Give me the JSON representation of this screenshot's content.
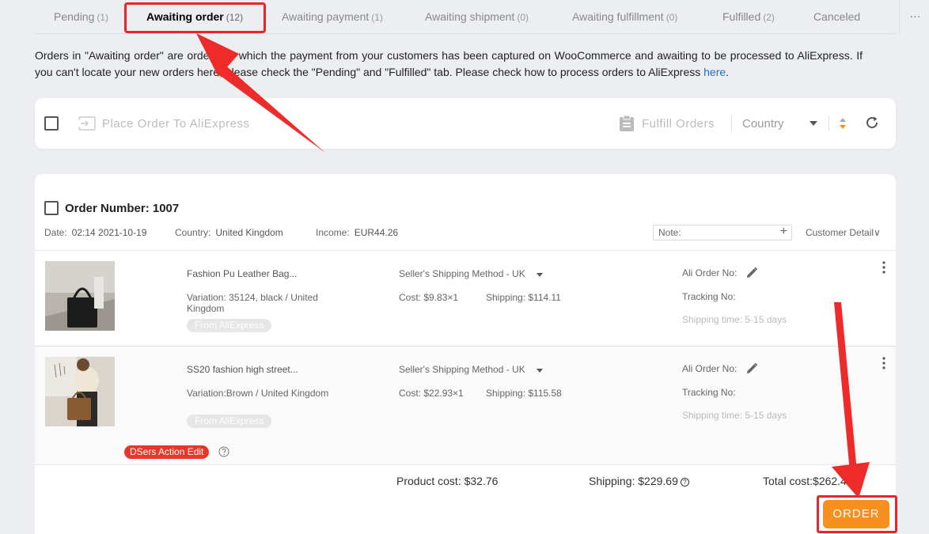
{
  "tabs": [
    {
      "label": "Pending",
      "count": "(1)"
    },
    {
      "label": "Awaiting order",
      "count": "(12)"
    },
    {
      "label": "Awaiting payment",
      "count": "(1)"
    },
    {
      "label": "Awaiting shipment",
      "count": "(0)"
    },
    {
      "label": "Awaiting fulfillment",
      "count": "(0)"
    },
    {
      "label": "Fulfilled",
      "count": "(2)"
    },
    {
      "label": "Canceled",
      "count": ""
    }
  ],
  "more_label": "···",
  "notice": {
    "text": "Orders in \"Awaiting order\" are orders for which the payment from your customers has been captured on WooCommerce and awaiting to be processed to AliExpress. If you can't locate your new orders here, please check the \"Pending\" and \"Fulfilled\" tab. Please check how to process orders to AliExpress ",
    "link": "here",
    "end": "."
  },
  "toolbar": {
    "place_order": "Place Order To AliExpress",
    "fulfill_orders": "Fulfill Orders",
    "country": "Country"
  },
  "order": {
    "number_label": "Order Number: 1007",
    "date_label": "Date:",
    "date_value": "02:14 2021-10-19",
    "country_label": "Country:",
    "country_value": "United Kingdom",
    "income_label": "Income:",
    "income_value": "EUR44.26",
    "note_placeholder": "Note:",
    "customer_detail": "Customer Detail",
    "items": [
      {
        "title": "Fashion Pu Leather Bag...",
        "variation": "Variation: 35124, black / United Kingdom",
        "source": "From AliExpress",
        "ship_method": "Seller's Shipping Method - UK",
        "cost": "Cost: $9.83×1",
        "shipping": "Shipping: $114.11",
        "ali_order": "Ali Order No:",
        "tracking": "Tracking No:",
        "ship_time": "Shipping time: 5-15 days"
      },
      {
        "title": "SS20 fashion high street...",
        "variation": "Variation:Brown / United Kingdom",
        "source": "From AliExpress",
        "ship_method": "Seller's Shipping Method - UK",
        "cost": "Cost: $22.93×1",
        "shipping": "Shipping: $115.58",
        "ali_order": "Ali Order No:",
        "tracking": "Tracking No:",
        "ship_time": "Shipping time: 5-15 days"
      }
    ],
    "dsers_badge": "DSers Action Edit",
    "product_cost": "Product cost: $32.76",
    "shipping_total": "Shipping: $229.69",
    "total_cost": "Total cost:$262.4",
    "order_button": "ORDER"
  },
  "colors": {
    "accent_orange": "#f7901e",
    "highlight_red": "#e8262a",
    "link_blue": "#1b6fd1",
    "badge_red": "#e8362a"
  }
}
